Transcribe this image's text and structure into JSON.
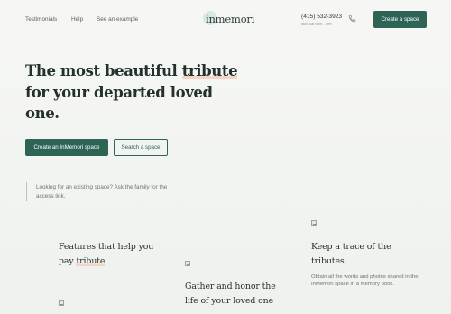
{
  "nav": {
    "links": [
      "Testimonials",
      "Help",
      "See an example"
    ],
    "logo": "inmemori",
    "phone": "(415) 532-3923",
    "hours": "Mon-Sat 9am - 7pm",
    "cta": "Create a space"
  },
  "hero": {
    "line1_pre": "The most beautiful ",
    "highlight": "tribute",
    "line2": "for your departed loved",
    "line3": "one.",
    "primary_button": "Create an InMemori space",
    "secondary_button": "Search a space",
    "note": "Looking for an existing space? Ask the family for the access link."
  },
  "features": {
    "heading_pre": "Features that help you",
    "heading_line2_pre": "pay ",
    "heading_highlight": "tribute",
    "gather_line1": "Gather and honor the",
    "gather_line2": "life of your loved one",
    "trace_line1": "Keep a trace of the",
    "trace_line2": "tributes",
    "trace_desc": "Obtain all the words and photos shared in the InMemori space in a memory book."
  },
  "colors": {
    "accent": "#2d6456",
    "highlight": "#f6d4c3",
    "background": "#f4f6f3"
  }
}
